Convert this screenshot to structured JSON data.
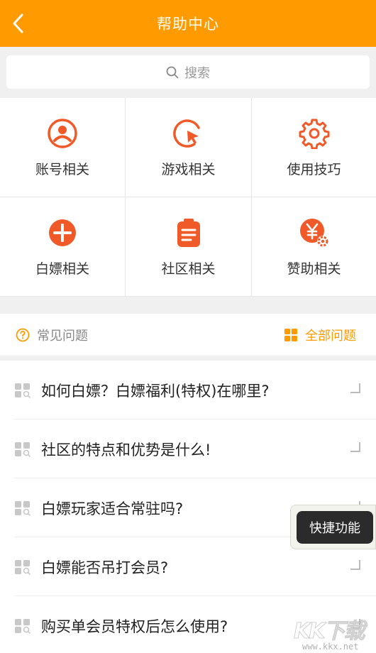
{
  "header": {
    "title": "帮助中心"
  },
  "search": {
    "placeholder": "搜索"
  },
  "categories": [
    {
      "label": "账号相关",
      "icon": "user-circle-icon"
    },
    {
      "label": "游戏相关",
      "icon": "cursor-click-icon"
    },
    {
      "label": "使用技巧",
      "icon": "gear-icon"
    },
    {
      "label": "白嫖相关",
      "icon": "plus-circle-icon"
    },
    {
      "label": "社区相关",
      "icon": "clipboard-icon"
    },
    {
      "label": "赞助相关",
      "icon": "yen-gear-icon"
    }
  ],
  "faq": {
    "title": "常见问题",
    "all_label": "全部问题",
    "questions": [
      "如何白嫖？白嫖福利(特权)在哪里?",
      "社区的特点和优势是什么!",
      "白嫖玩家适合常驻吗?",
      "白嫖能否吊打会员?",
      "购买单会员特权后怎么使用?"
    ]
  },
  "floating": {
    "quick_label": "快捷功能"
  },
  "watermark": {
    "text": "KK下载",
    "url": "www.kkx.net"
  },
  "colors": {
    "accent": "#ff9a00",
    "icon_red": "#f05a28"
  }
}
